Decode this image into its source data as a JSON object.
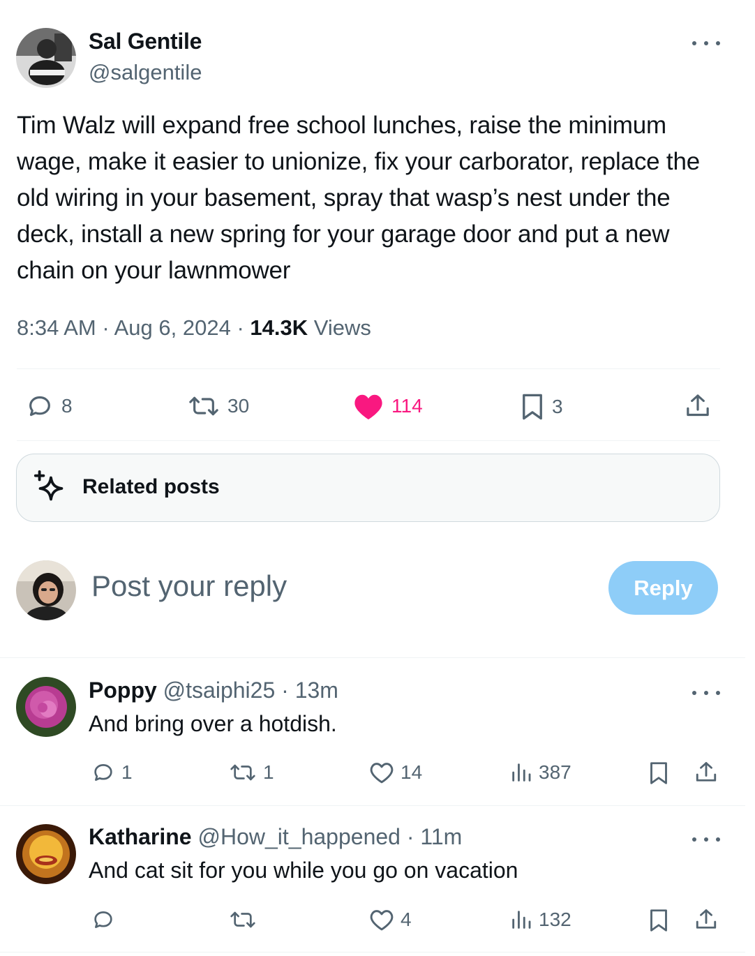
{
  "tweet": {
    "author_name": "Sal Gentile",
    "author_handle": "@salgentile",
    "text": "Tim Walz will expand free school lunches, raise the minimum wage, make it easier to unionize, fix your carborator, replace the old wiring in your basement, spray that wasp’s nest under the deck, install a new spring for your garage door and put a new chain on your lawnmower",
    "time": "8:34 AM",
    "date": "Aug 6, 2024",
    "separator": "·",
    "views_count": "14.3K",
    "views_label": "Views",
    "replies": "8",
    "reposts": "30",
    "likes": "114",
    "bookmarks": "3",
    "like_color": "#f91880"
  },
  "related": {
    "label": "Related posts"
  },
  "composer": {
    "placeholder": "Post your reply",
    "button": "Reply"
  },
  "replies": [
    {
      "name": "Poppy",
      "handle": "@tsaiphi25",
      "age": "13m",
      "text": "And bring over a hotdish.",
      "replies": "1",
      "reposts": "1",
      "likes": "14",
      "views": "387"
    },
    {
      "name": "Katharine",
      "handle": "@How_it_happened",
      "age": "11m",
      "text": "And cat sit for you while you go on vacation",
      "replies": "",
      "reposts": "",
      "likes": "4",
      "views": "132"
    }
  ]
}
